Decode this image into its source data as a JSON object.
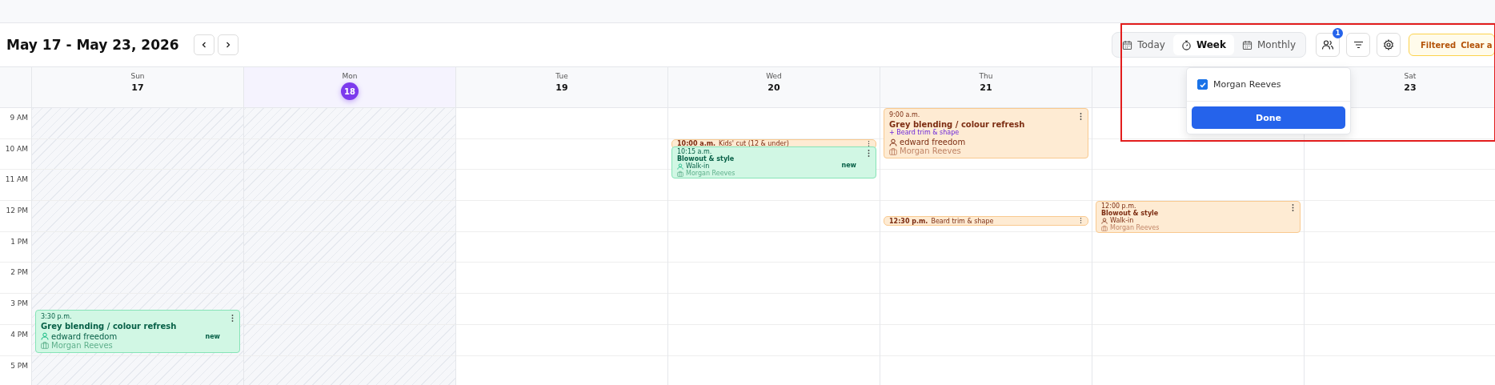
{
  "header": {
    "title": "May 17 - May 23, 2026"
  },
  "views": [
    {
      "label": "Today",
      "selected": false,
      "kind": "calendar"
    },
    {
      "label": "Week",
      "selected": true,
      "kind": "timer"
    },
    {
      "label": "Monthly",
      "selected": false,
      "kind": "calendar"
    }
  ],
  "staff_filter": {
    "badge": "1"
  },
  "filter_chip": {
    "label": "Filtered",
    "action": "Clear a"
  },
  "hours": [
    "9 AM",
    "10 AM",
    "11 AM",
    "12 PM",
    "1 PM",
    "2 PM",
    "3 PM",
    "4 PM",
    "5 PM"
  ],
  "days": [
    {
      "name": "Sun",
      "date": "17",
      "selected": false,
      "past": true,
      "events": [
        {
          "kind": "card",
          "color": "#d1f7e4",
          "time": "3:30 p.m.",
          "title": "Grey blending / colour refresh",
          "client": "edward freedom",
          "staff": "Morgan Reeves",
          "badge": "new"
        }
      ]
    },
    {
      "name": "Mon",
      "date": "18",
      "selected": true,
      "past": true
    },
    {
      "name": "Tue",
      "date": "19",
      "selected": false,
      "past": false
    },
    {
      "name": "Wed",
      "date": "20",
      "selected": false,
      "past": false,
      "events": [
        {
          "kind": "pill",
          "color": "#feebd3",
          "time": "10:00 a.m.",
          "title": "Kids' cut (12 & under)"
        },
        {
          "kind": "mini",
          "color": "#d1f7e4",
          "time": "10:15 a.m.",
          "title": "Blowout & style",
          "client": "Walk-in",
          "staff": "Morgan Reeves",
          "badge": "new"
        }
      ]
    },
    {
      "name": "Thu",
      "date": "21",
      "selected": false,
      "past": false,
      "events": [
        {
          "kind": "card",
          "color": "#feebd3",
          "time": "9:00 a.m.",
          "title": "Grey blending / colour refresh",
          "addon": "+ Beard trim & shape",
          "client": "edward freedom",
          "staff": "Morgan Reeves"
        },
        {
          "kind": "pill",
          "color": "#feebd3",
          "time": "12:30 p.m.",
          "title": "Beard trim & shape"
        }
      ]
    },
    {
      "past": false,
      "events": [
        {
          "kind": "mini",
          "color": "#feebd3",
          "time": "12:00 p.m.",
          "title": "Blowout & style",
          "client": "Walk-in",
          "staff": "Morgan Reeves"
        }
      ]
    },
    {
      "name": "Sat",
      "date": "23",
      "selected": false,
      "past": false
    }
  ],
  "staff_menu": {
    "options": [
      {
        "label": "Morgan Reeves",
        "checked": true
      }
    ],
    "button": "Done"
  }
}
